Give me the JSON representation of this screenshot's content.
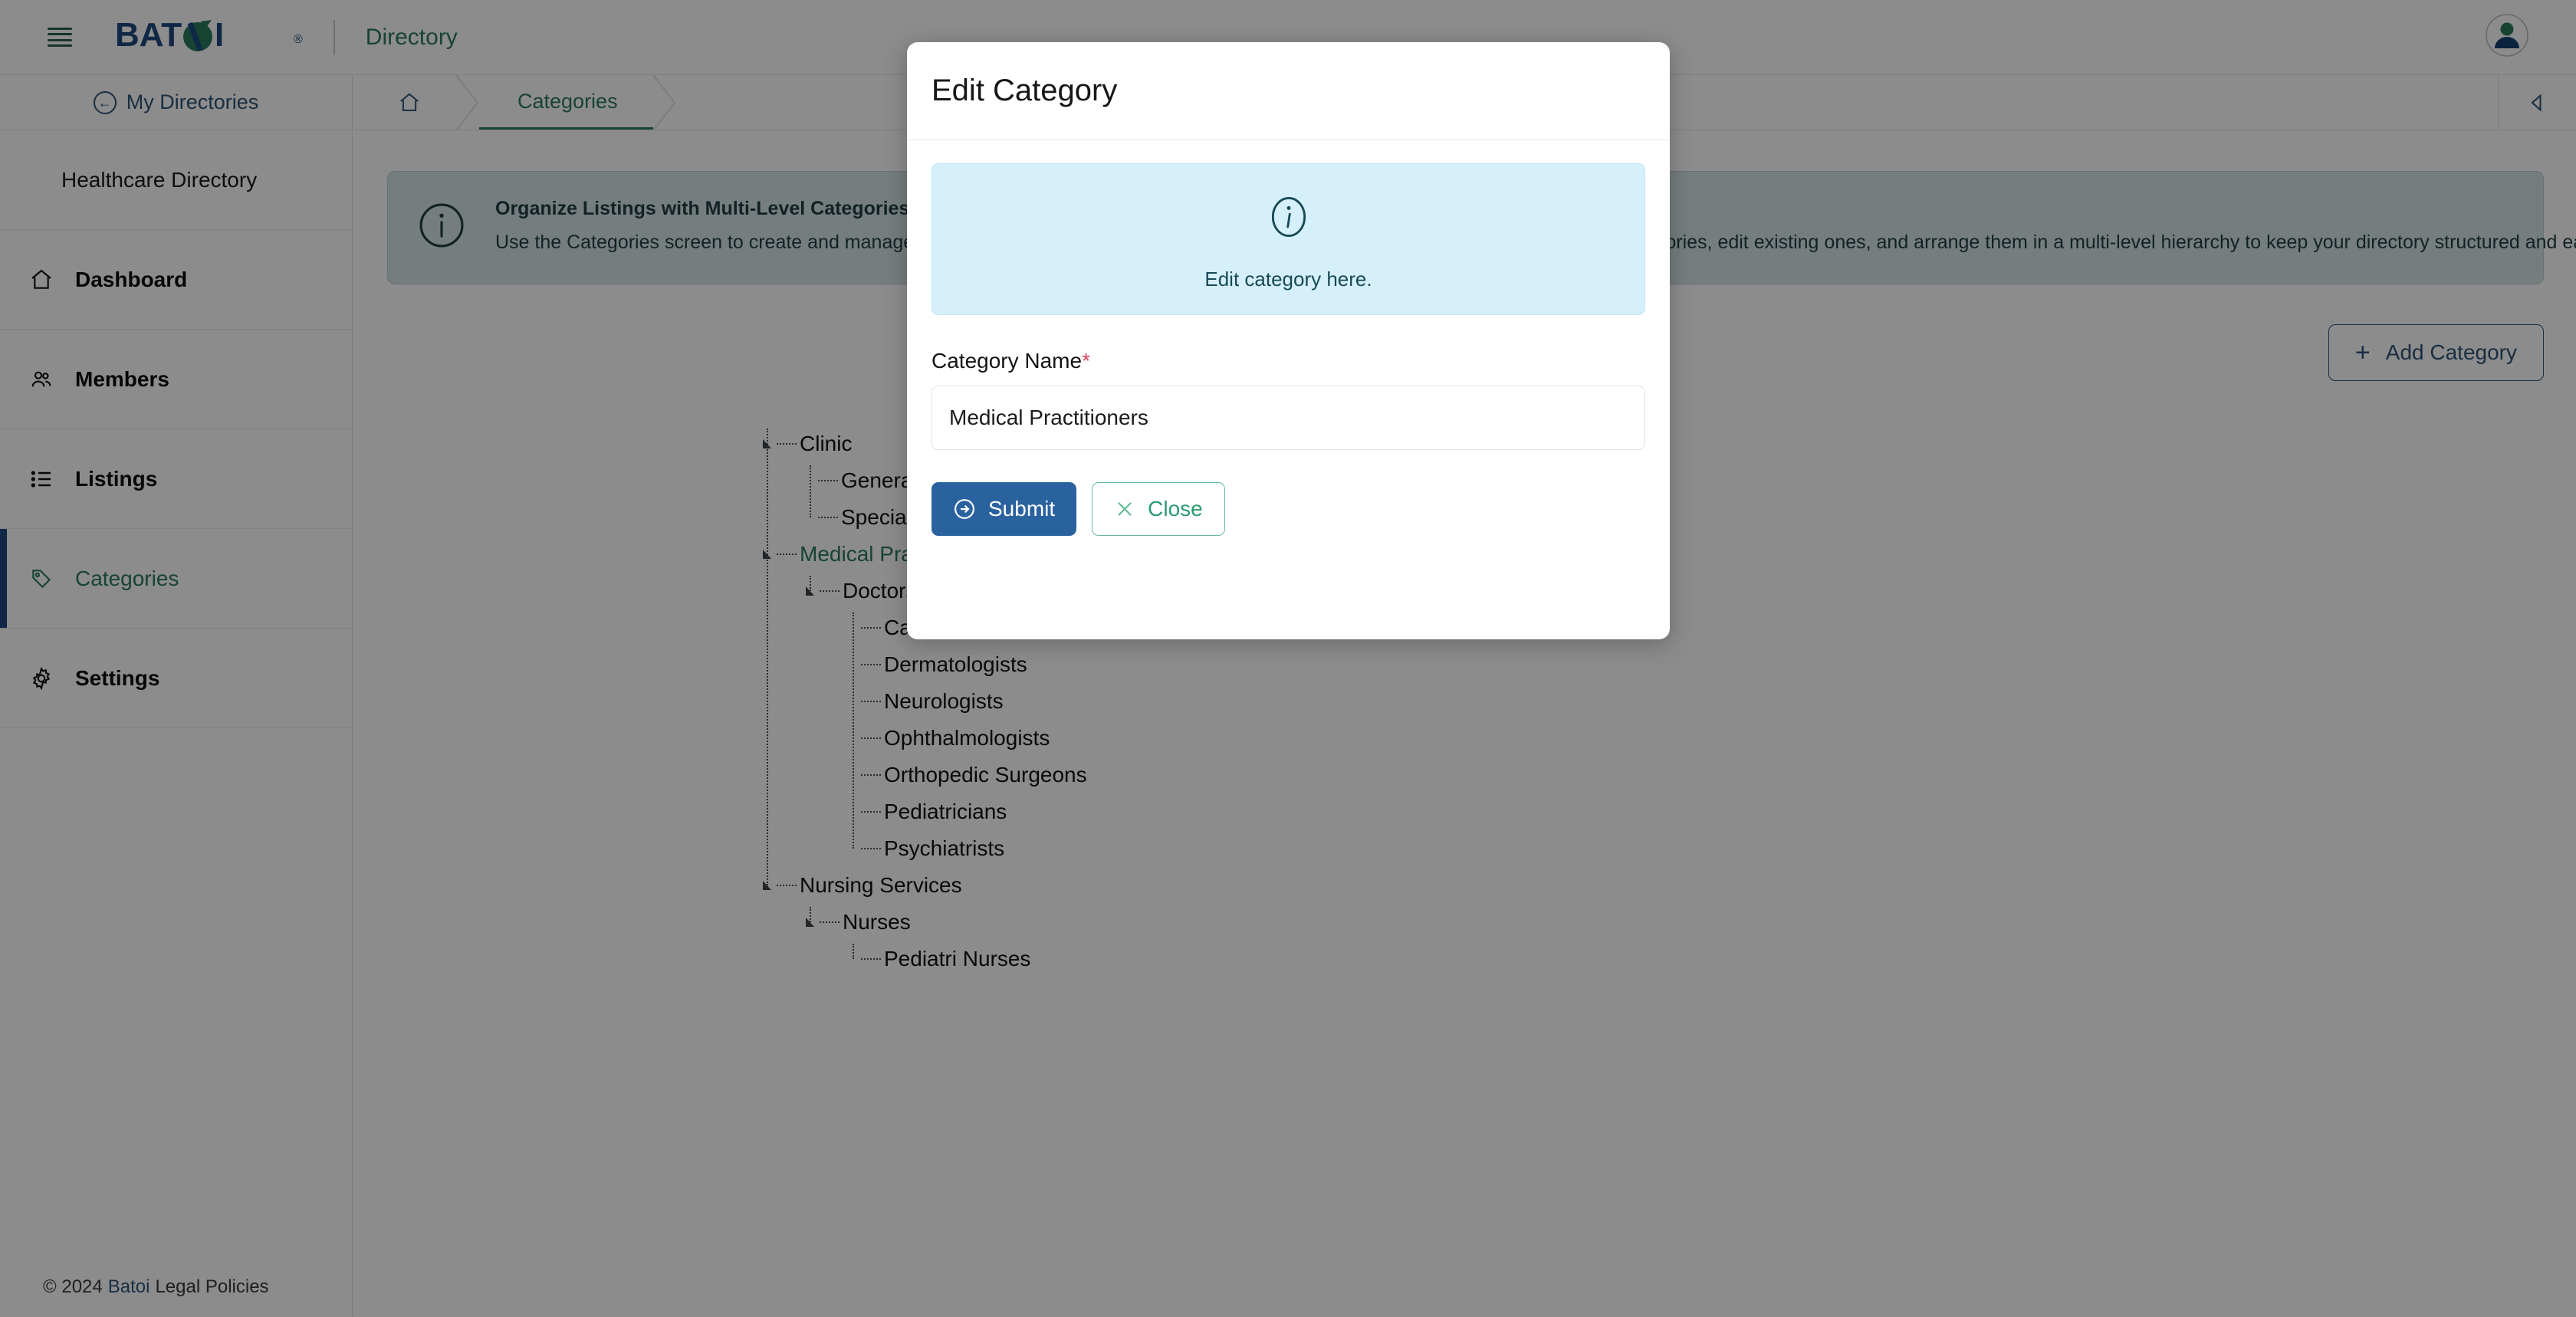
{
  "navbar": {
    "menu_icon": "hamburger-icon",
    "brand": "BATOI",
    "brand_mark": "®",
    "app_title": "Directory",
    "avatar_icon": "user-avatar-icon"
  },
  "sidebar": {
    "back_label": "My Directories",
    "directory_name": "Healthcare Directory",
    "items": [
      {
        "label": "Dashboard",
        "icon": "home-icon",
        "active": false
      },
      {
        "label": "Members",
        "icon": "users-icon",
        "active": false
      },
      {
        "label": "Listings",
        "icon": "list-icon",
        "active": false
      },
      {
        "label": "Categories",
        "icon": "tag-icon",
        "active": true
      },
      {
        "label": "Settings",
        "icon": "gear-icon",
        "active": false
      }
    ]
  },
  "footer": {
    "copyright": "© 2024",
    "brand_link": "Batoi",
    "legal_link": "Legal Policies"
  },
  "breadcrumb": {
    "home_icon": "home-icon",
    "items": [
      "Categories"
    ],
    "collapse_icon": "caret-left-icon"
  },
  "banner": {
    "icon": "info-circle-icon",
    "title": "Organize Listings with Multi-Level Categories",
    "body": "Use the Categories screen to create and manage categories that help users find the information they need more efficiently. Add new categories, edit existing ones, and arrange them in a multi-level hierarchy to keep your directory structured and easy to navigate."
  },
  "toolbar": {
    "add_category_label": "Add Category",
    "add_icon": "plus-icon"
  },
  "tree": {
    "nodes": [
      {
        "label": "Clinic",
        "depth": 0,
        "toggle": true,
        "selected": false
      },
      {
        "label": "General Clinics",
        "depth": 1,
        "toggle": false,
        "selected": false
      },
      {
        "label": "Specialty Clinics",
        "depth": 1,
        "toggle": false,
        "selected": false
      },
      {
        "label": "Medical Practitioners",
        "depth": 0,
        "toggle": true,
        "selected": true
      },
      {
        "label": "Doctors",
        "depth": 1,
        "toggle": true,
        "selected": false
      },
      {
        "label": "Cardiologists",
        "depth": 2,
        "toggle": false,
        "selected": false
      },
      {
        "label": "Dermatologists",
        "depth": 2,
        "toggle": false,
        "selected": false
      },
      {
        "label": "Neurologists",
        "depth": 2,
        "toggle": false,
        "selected": false
      },
      {
        "label": "Ophthalmologists",
        "depth": 2,
        "toggle": false,
        "selected": false
      },
      {
        "label": "Orthopedic Surgeons",
        "depth": 2,
        "toggle": false,
        "selected": false
      },
      {
        "label": "Pediatricians",
        "depth": 2,
        "toggle": false,
        "selected": false
      },
      {
        "label": "Psychiatrists",
        "depth": 2,
        "toggle": false,
        "selected": false
      },
      {
        "label": "Nursing Services",
        "depth": 0,
        "toggle": true,
        "selected": false
      },
      {
        "label": "Nurses",
        "depth": 1,
        "toggle": true,
        "selected": false
      },
      {
        "label": "Pediatri Nurses",
        "depth": 2,
        "toggle": false,
        "selected": false
      }
    ]
  },
  "modal": {
    "title": "Edit Category",
    "info_icon": "info-circle-icon",
    "info_text": "Edit category here.",
    "field_label": "Category Name",
    "field_required_mark": "*",
    "field_value": "Medical Practitioners",
    "field_placeholder": "Category Name",
    "submit_label": "Submit",
    "submit_icon": "arrow-right-circle-icon",
    "close_label": "Close",
    "close_icon": "close-x-icon"
  },
  "colors": {
    "brand_blue": "#1e4a80",
    "brand_green": "#2b7a5e",
    "primary_button": "#2a629f",
    "ghost_button": "#2b9a70",
    "required": "#d6455c",
    "modal_info_bg": "#d6f0fb",
    "banner_bg": "#d5e3e6"
  }
}
